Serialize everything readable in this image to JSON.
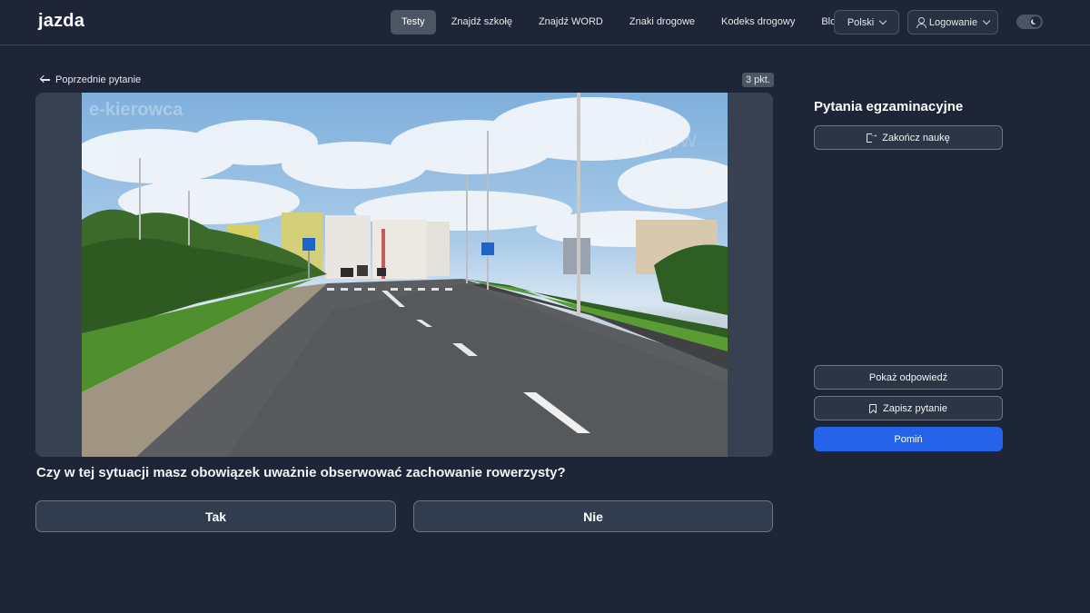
{
  "header": {
    "logo": "jazda",
    "nav": [
      {
        "label": "Testy",
        "active": true
      },
      {
        "label": "Znajdź szkołę",
        "active": false
      },
      {
        "label": "Znajdź WORD",
        "active": false
      },
      {
        "label": "Znaki drogowe",
        "active": false
      },
      {
        "label": "Kodeks drogowy",
        "active": false
      },
      {
        "label": "Blog",
        "active": false
      }
    ],
    "language": "Polski",
    "login": "Logowanie"
  },
  "main": {
    "back_label": "Poprzednie pytanie",
    "points": "3 pkt.",
    "question": "Czy w tej sytuacji masz obowiązek uważnie obserwować zachowanie rowerzysty?",
    "answers": {
      "yes": "Tak",
      "no": "Nie"
    }
  },
  "sidebar": {
    "title": "Pytania egzaminacyjne",
    "end_label": "Zakończ naukę",
    "show_answer_label": "Pokaż odpowiedź",
    "save_label": "Zapisz pytanie",
    "skip_label": "Pomiń"
  },
  "colors": {
    "background": "#1e2536",
    "accent": "#2563eb",
    "logo_accent": "#3b82f6"
  }
}
